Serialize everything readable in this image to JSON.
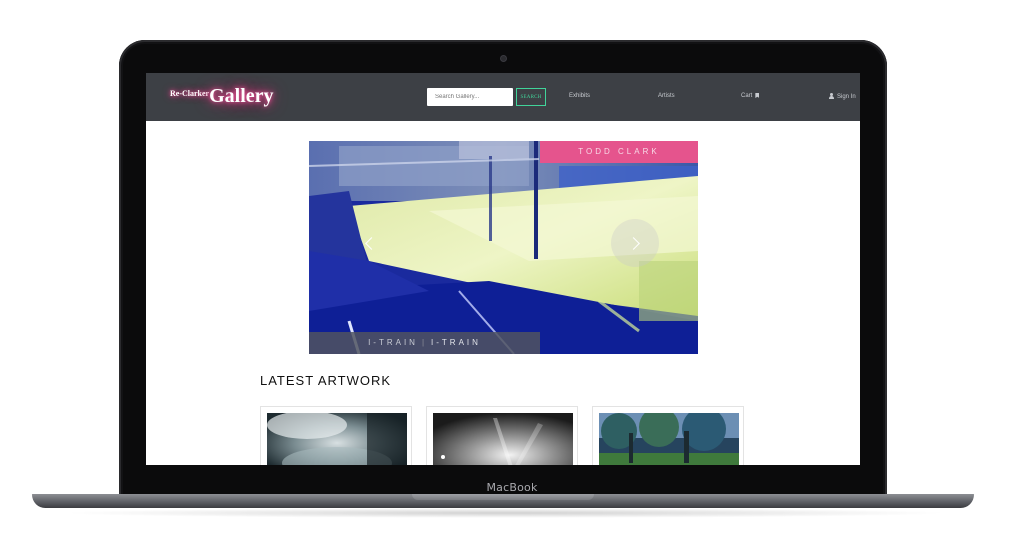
{
  "device": {
    "brand_label": "MacBook"
  },
  "navbar": {
    "logo_small": "Re-Clarker",
    "logo_big": "Gallery",
    "search": {
      "placeholder": "Search Gallery...",
      "button_label": "SEARCH"
    },
    "links": {
      "exhibits": "Exhibits",
      "artists": "Artists",
      "cart": "Cart",
      "sign_in": "Sign In"
    },
    "colors": {
      "background": "#3d4045",
      "search_accent": "#41d49a",
      "logo_glow": "#e63b86"
    }
  },
  "carousel": {
    "artist_name": "TODD CLARK",
    "caption_primary": "I-TRAIN",
    "caption_separator": "|",
    "caption_secondary": "I-TRAIN",
    "prev_icon": "chevron-left-icon",
    "next_icon": "chevron-right-icon",
    "colors": {
      "banner": "#e5548d"
    }
  },
  "latest": {
    "heading": "LATEST ARTWORK",
    "cards": [
      {
        "image": "abstract-hands-image"
      },
      {
        "image": "light-burst-image"
      },
      {
        "image": "tree-canopy-image"
      }
    ]
  }
}
